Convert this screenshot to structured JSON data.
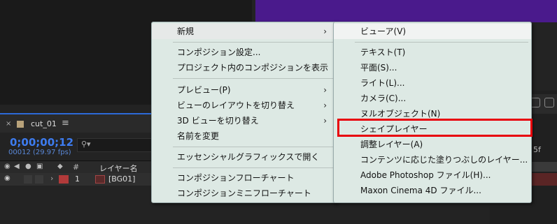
{
  "timeline": {
    "close_glyph": "×",
    "comp_name": "cut_01",
    "menu_glyph": "≡",
    "timecode": "0;00;00;12",
    "frames": "00012 (29.97 fps)",
    "search_glyph": "⚲▾",
    "header": {
      "hash": "#",
      "layer_name": "レイヤー名"
    },
    "row": {
      "arrow": "›",
      "number": "1",
      "name": "[BG01]"
    }
  },
  "right_panel": {
    "text": "5f"
  },
  "context_menu": {
    "items": [
      {
        "label": "新規",
        "arrow": "›"
      },
      {
        "label": "コンポジション設定..."
      },
      {
        "label": "プロジェクト内のコンポジションを表示"
      },
      {
        "label": "プレビュー(P)",
        "arrow": "›"
      },
      {
        "label": "ビューのレイアウトを切り替え",
        "arrow": "›"
      },
      {
        "label": "3D ビューを切り替え",
        "arrow": "›"
      },
      {
        "label": "名前を変更"
      },
      {
        "label": "エッセンシャルグラフィックスで開く"
      },
      {
        "label": "コンポジションフローチャート"
      },
      {
        "label": "コンポジションミニフローチャート"
      }
    ]
  },
  "submenu": {
    "items": [
      {
        "label": "ビューア(V)"
      },
      {
        "label": "テキスト(T)"
      },
      {
        "label": "平面(S)..."
      },
      {
        "label": "ライト(L)..."
      },
      {
        "label": "カメラ(C)..."
      },
      {
        "label": "ヌルオブジェクト(N)"
      },
      {
        "label": "シェイプレイヤー"
      },
      {
        "label": "調整レイヤー(A)"
      },
      {
        "label": "コンテンツに応じた塗りつぶしのレイヤー..."
      },
      {
        "label": "Adobe Photoshop ファイル(H)..."
      },
      {
        "label": "Maxon Cinema 4D ファイル..."
      }
    ]
  },
  "highlight_color": "#e8000a"
}
